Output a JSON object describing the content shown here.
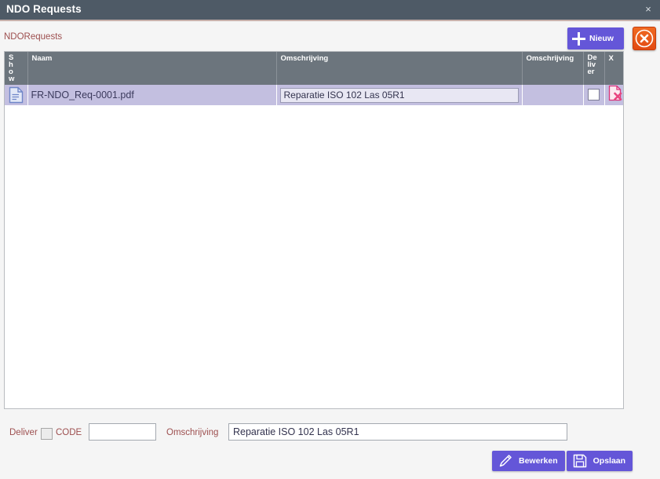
{
  "window": {
    "title": "NDO Requests",
    "close_glyph": "×"
  },
  "toolbar": {
    "breadcrumb": "NDORequests",
    "new_button_label": "Nieuw",
    "new_button_icon": "plus-icon",
    "close_button_icon": "close-circle-icon",
    "accent_purple": "#6456d8",
    "accent_orange": "#e24a12",
    "label_maroon": "#9d4f4f",
    "header_gray": "#6c757d",
    "titlebar_slate": "#4e5a66",
    "row_lavender": "#c3bfe0"
  },
  "grid": {
    "columns": [
      {
        "key": "show",
        "label": "Show",
        "wrapped": "Sh\no\nw"
      },
      {
        "key": "naam",
        "label": "Naam",
        "wrapped": "Naam"
      },
      {
        "key": "oms_grid",
        "label": "Omschrijving",
        "wrapped": "Omschrijving"
      },
      {
        "key": "oms2",
        "label": "Omschrijving",
        "wrapped": "Omschrijving"
      },
      {
        "key": "deliver",
        "label": "Deliver",
        "wrapped": "De\nliv\ner"
      },
      {
        "key": "x",
        "label": "X",
        "wrapped": "X"
      }
    ],
    "rows": [
      {
        "show_icon": "document-icon",
        "naam": "FR-NDO_Req-0001.pdf",
        "omschrijving_value": "Reparatie ISO 102 Las 05R1",
        "oms2": "",
        "deliver_checked": false,
        "delete_icon": "document-delete-icon"
      }
    ]
  },
  "form": {
    "deliver_label": "Deliver",
    "deliver_checked": false,
    "code_label": "CODE",
    "code_value": "",
    "omschrijving_label": "Omschrijving",
    "omschrijving_value": "Reparatie ISO 102 Las 05R1"
  },
  "actions": {
    "edit_label": "Bewerken",
    "edit_icon": "pencil-icon",
    "save_label": "Opslaan",
    "save_icon": "floppy-disk-icon"
  }
}
